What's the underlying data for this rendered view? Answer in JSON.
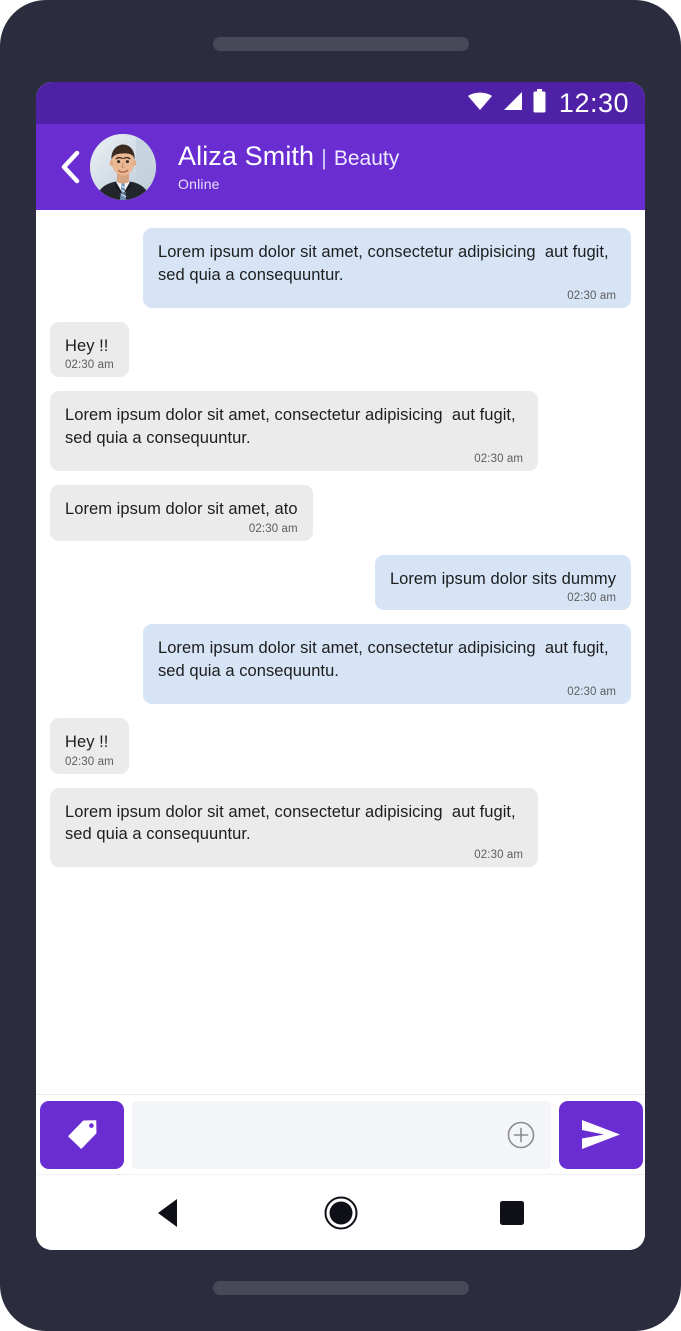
{
  "status_bar": {
    "time": "12:30",
    "icons": [
      "wifi-icon",
      "cellular-signal-icon",
      "battery-icon"
    ]
  },
  "app_bar": {
    "back_icon": "chevron-left-icon",
    "avatar": "contact-avatar",
    "contact_name": "Aliza Smith",
    "separator": "|",
    "contact_category": "Beauty",
    "status": "Online"
  },
  "colors": {
    "status_bar_purple": "#4f21a6",
    "app_bar_purple": "#6a2dd2",
    "accent_purple": "#6a2dd2",
    "incoming_bubble": "#ebebeb",
    "outgoing_bubble": "#d6e4f6",
    "frame_dark": "#2b2c3e",
    "text_primary": "#1d1d1d",
    "timestamp_gray": "#5d5d5d"
  },
  "messages": [
    {
      "direction": "outgoing",
      "text": "Lorem ipsum dolor sit amet, consectetur adipisicing  aut fugit, sed quia a consequuntur.",
      "time": "02:30 am"
    },
    {
      "direction": "incoming",
      "text": "Hey !!",
      "time": "02:30 am"
    },
    {
      "direction": "incoming",
      "text": "Lorem ipsum dolor sit amet, consectetur adipisicing  aut fugit, sed quia a consequuntur.",
      "time": "02:30 am"
    },
    {
      "direction": "incoming",
      "text": "Lorem ipsum dolor sit amet, ato",
      "time": "02:30 am"
    },
    {
      "direction": "outgoing",
      "text": "Lorem ipsum dolor sits dummy",
      "time": "02:30 am"
    },
    {
      "direction": "outgoing",
      "text": "Lorem ipsum dolor sit amet, consectetur adipisicing  aut fugit, sed quia a consequuntu.",
      "time": "02:30 am"
    },
    {
      "direction": "incoming",
      "text": "Hey !!",
      "time": "02:30 am"
    },
    {
      "direction": "incoming",
      "text": "Lorem ipsum dolor sit amet, consectetur adipisicing  aut fugit, sed quia a consequuntur.",
      "time": "02:30 am"
    }
  ],
  "input_bar": {
    "tag_icon": "tag-icon",
    "input_value": "",
    "input_placeholder": "",
    "attach_icon": "plus-circle-icon",
    "send_icon": "send-paper-plane-icon"
  },
  "nav_bar": {
    "back_icon": "nav-back-triangle-icon",
    "home_icon": "nav-home-circle-icon",
    "recents_icon": "nav-recents-square-icon"
  }
}
